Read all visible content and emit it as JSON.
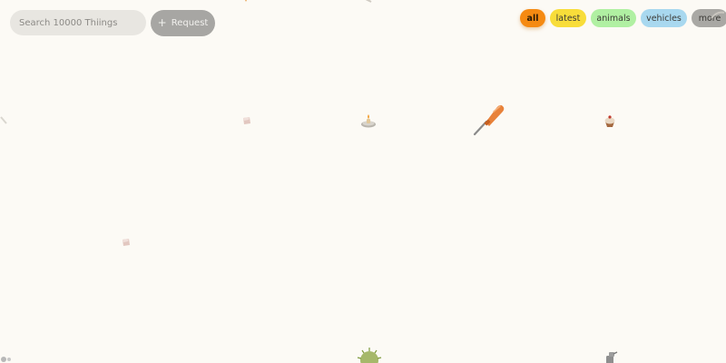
{
  "search": {
    "placeholder": "Search 10000 Thiings"
  },
  "request_button": {
    "label": "Request",
    "icon": "plus-icon"
  },
  "filters": [
    {
      "label": "all",
      "active": true,
      "color": "#f58a12"
    },
    {
      "label": "latest",
      "active": false,
      "color": "#f8dd3a"
    },
    {
      "label": "animals",
      "active": false,
      "color": "#b0f0a2"
    },
    {
      "label": "vehicles",
      "active": false,
      "color": "#a8d8ef"
    },
    {
      "label": "more",
      "active": false,
      "color": "#a9a8a4"
    }
  ],
  "colors": {
    "background": "#fcfaf5",
    "search_bg": "#e8e6e1",
    "request_bg": "#a7a6a3"
  },
  "things": [
    {
      "name": "screwdriver-icon"
    },
    {
      "name": "candle-dish-icon"
    },
    {
      "name": "cupcake-icon"
    },
    {
      "name": "sugar-cube-icon"
    },
    {
      "name": "cactus-ball-icon"
    },
    {
      "name": "robot-figure-icon"
    }
  ]
}
